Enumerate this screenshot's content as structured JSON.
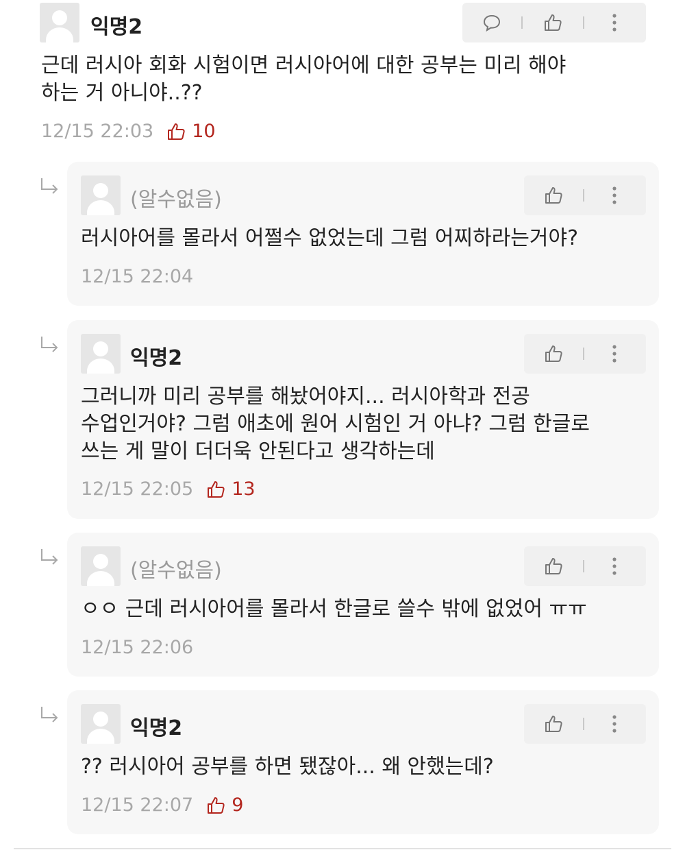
{
  "comments": [
    {
      "nickname": "익명2",
      "text": "근데 러시아 회화 시험이면 러시아어에 대한 공부는 미리 해야\n하는 거 아니야..??",
      "time": "12/15 22:03",
      "likes": "10"
    }
  ],
  "replies": [
    {
      "nickname": "(알수없음)",
      "text": "러시아어를 몰라서 어쩔수 없었는데 그럼 어찌하라는거야?",
      "time": "12/15 22:04",
      "likes": ""
    },
    {
      "nickname": "익명2",
      "text": "그러니까 미리 공부를 해놨어야지... 러시아학과 전공\n수업인거야? 그럼 애초에 원어 시험인 거 아냐? 그럼 한글로\n쓰는 게 말이 더더욱 안된다고 생각하는데",
      "time": "12/15 22:05",
      "likes": "13"
    },
    {
      "nickname": "(알수없음)",
      "text": "ㅇㅇ 근데 러시아어를 몰라서 한글로 쓸수 밖에 없었어 ㅠㅠ",
      "time": "12/15 22:06",
      "likes": ""
    },
    {
      "nickname": "익명2",
      "text": "?? 러시아어 공부를 하면 됐잖아... 왜 안했는데?",
      "time": "12/15 22:07",
      "likes": "9"
    }
  ],
  "colors": {
    "like": "#b3261e",
    "time": "#a8a8a8",
    "card": "#f7f7f7",
    "action_bar": "#f0f0f0"
  },
  "icons": [
    "comment-icon",
    "thumbs-up-icon",
    "more-vertical-icon",
    "reply-arrow-icon",
    "avatar-icon"
  ]
}
